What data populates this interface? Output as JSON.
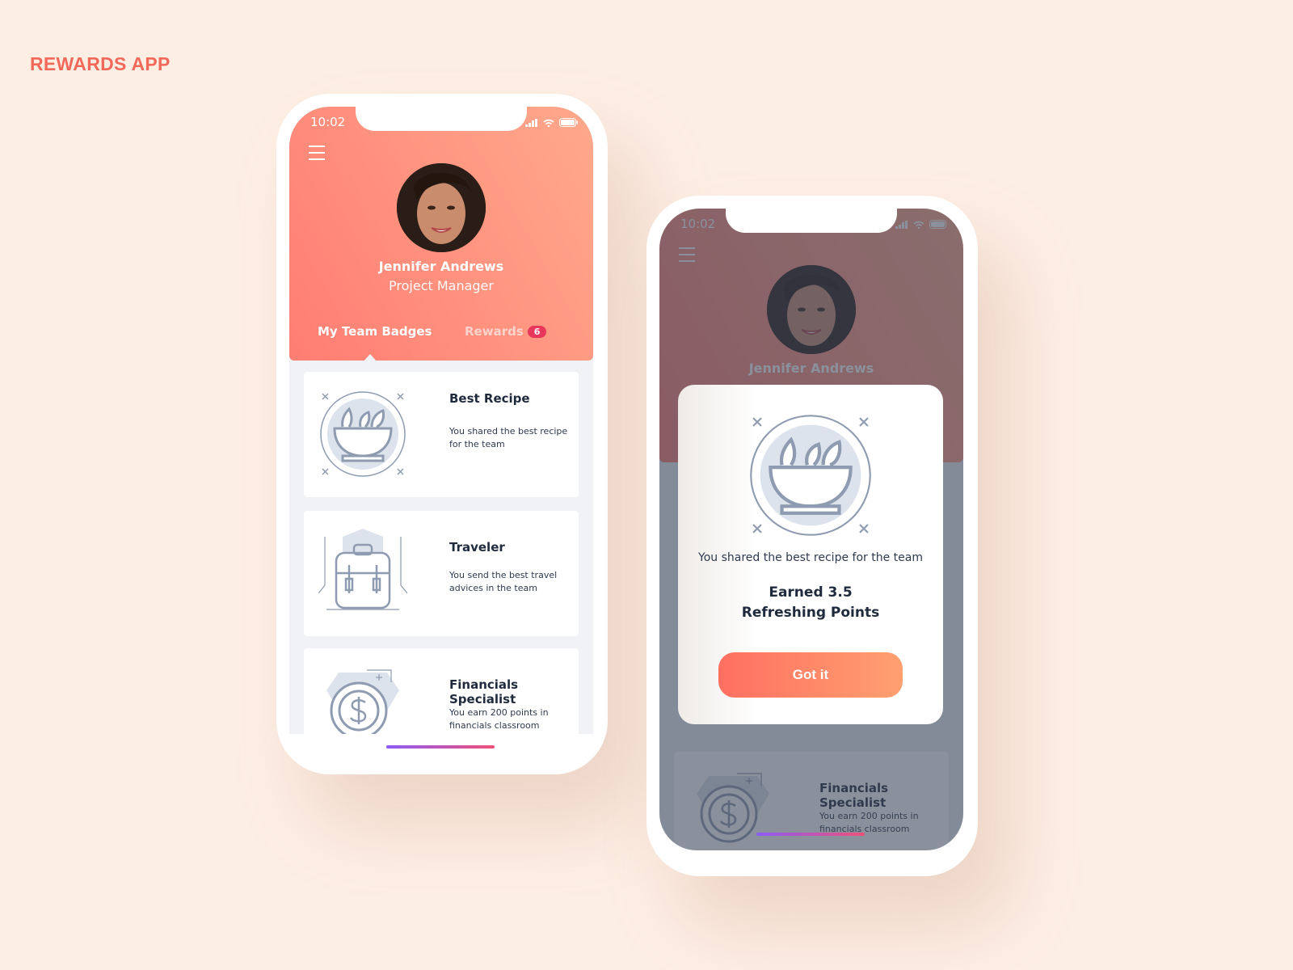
{
  "app_title": "REWARDS APP",
  "status": {
    "time": "10:02"
  },
  "profile": {
    "name": "Jennifer Andrews",
    "role": "Project Manager"
  },
  "tabs": [
    {
      "label": "My Team Badges",
      "active": true
    },
    {
      "label": "Rewards",
      "count": "6"
    }
  ],
  "badges": [
    {
      "title": "Best Recipe",
      "description": "You shared the best recipe for the team",
      "icon": "salad-bowl-icon"
    },
    {
      "title": "Traveler",
      "description": "You send the best travel advices in the team",
      "icon": "backpack-icon"
    },
    {
      "title": "Financials Specialist",
      "description": "You earn 200 points in financials classroom",
      "icon": "dollar-coin-icon"
    }
  ],
  "modal": {
    "description": "You shared the best recipe for the team",
    "points_line1": "Earned 3.5",
    "points_line2": "Refreshing Points",
    "button": "Got it"
  },
  "colors": {
    "accent": "#ff7d72",
    "accent_end": "#ffa98c",
    "badge": "#e8375a",
    "title": "#f2695a"
  }
}
